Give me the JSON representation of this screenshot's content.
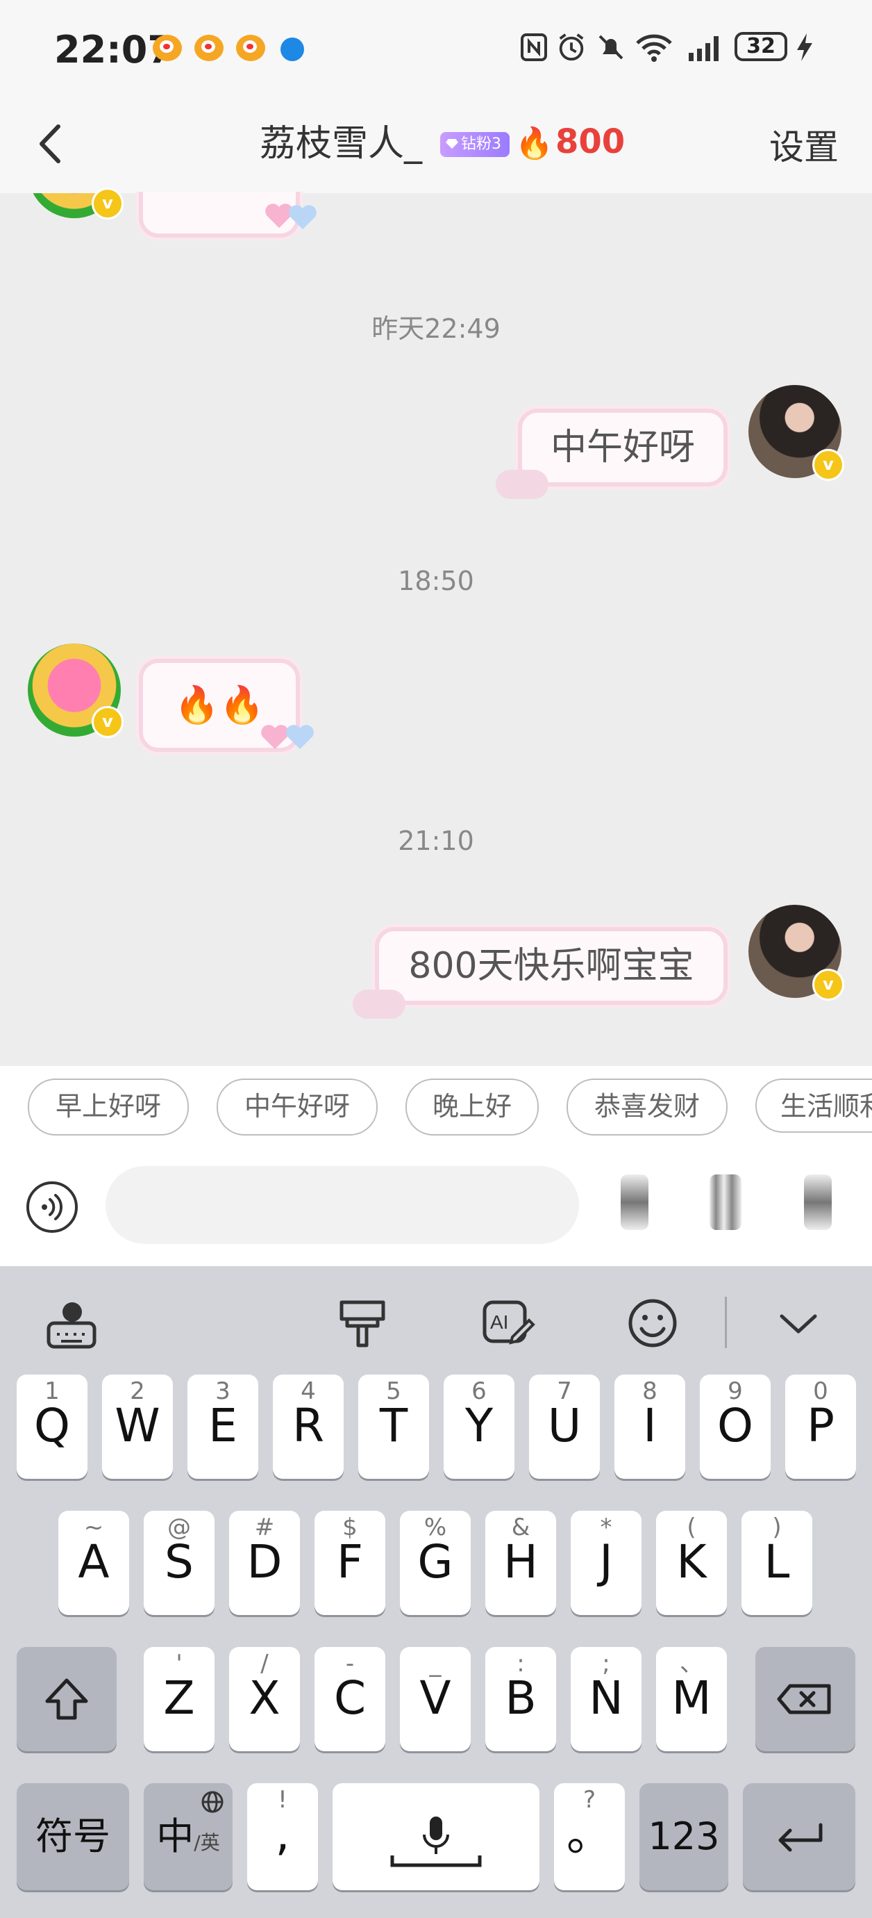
{
  "status_bar": {
    "time": "22:07",
    "battery": "32"
  },
  "header": {
    "title": "荔枝雪人_",
    "fan_badge": "钻粉3",
    "fire_count": "800",
    "settings_label": "设置"
  },
  "messages": [
    {
      "type": "timestamp",
      "text": "昨天22:49"
    },
    {
      "type": "sent",
      "text": "中午好呀"
    },
    {
      "type": "timestamp",
      "text": "18:50"
    },
    {
      "type": "received",
      "text": "🔥🔥"
    },
    {
      "type": "timestamp",
      "text": "21:10"
    },
    {
      "type": "sent",
      "text": "800天快乐啊宝宝"
    }
  ],
  "quick_replies": [
    "早上好呀",
    "中午好呀",
    "晚上好",
    "恭喜发财",
    "生活顺利"
  ],
  "input": {
    "placeholder": ""
  },
  "keyboard": {
    "row1": [
      {
        "hint": "1",
        "key": "Q"
      },
      {
        "hint": "2",
        "key": "W"
      },
      {
        "hint": "3",
        "key": "E"
      },
      {
        "hint": "4",
        "key": "R"
      },
      {
        "hint": "5",
        "key": "T"
      },
      {
        "hint": "6",
        "key": "Y"
      },
      {
        "hint": "7",
        "key": "U"
      },
      {
        "hint": "8",
        "key": "I"
      },
      {
        "hint": "9",
        "key": "O"
      },
      {
        "hint": "0",
        "key": "P"
      }
    ],
    "row2": [
      {
        "hint": "~",
        "key": "A"
      },
      {
        "hint": "@",
        "key": "S"
      },
      {
        "hint": "#",
        "key": "D"
      },
      {
        "hint": "$",
        "key": "F"
      },
      {
        "hint": "%",
        "key": "G"
      },
      {
        "hint": "&",
        "key": "H"
      },
      {
        "hint": "*",
        "key": "J"
      },
      {
        "hint": "(",
        "key": "K"
      },
      {
        "hint": ")",
        "key": "L"
      }
    ],
    "row3": [
      {
        "hint": "'",
        "key": "Z"
      },
      {
        "hint": "/",
        "key": "X"
      },
      {
        "hint": "-",
        "key": "C"
      },
      {
        "hint": "_",
        "key": "V"
      },
      {
        "hint": ":",
        "key": "B"
      },
      {
        "hint": ";",
        "key": "N"
      },
      {
        "hint": "、",
        "key": "M"
      }
    ],
    "symbols_label": "符号",
    "lang_label": "中",
    "lang_sub": "/英",
    "comma_hint": "!",
    "comma": ",",
    "period_hint": "?",
    "period": "。",
    "num_label": "123"
  }
}
